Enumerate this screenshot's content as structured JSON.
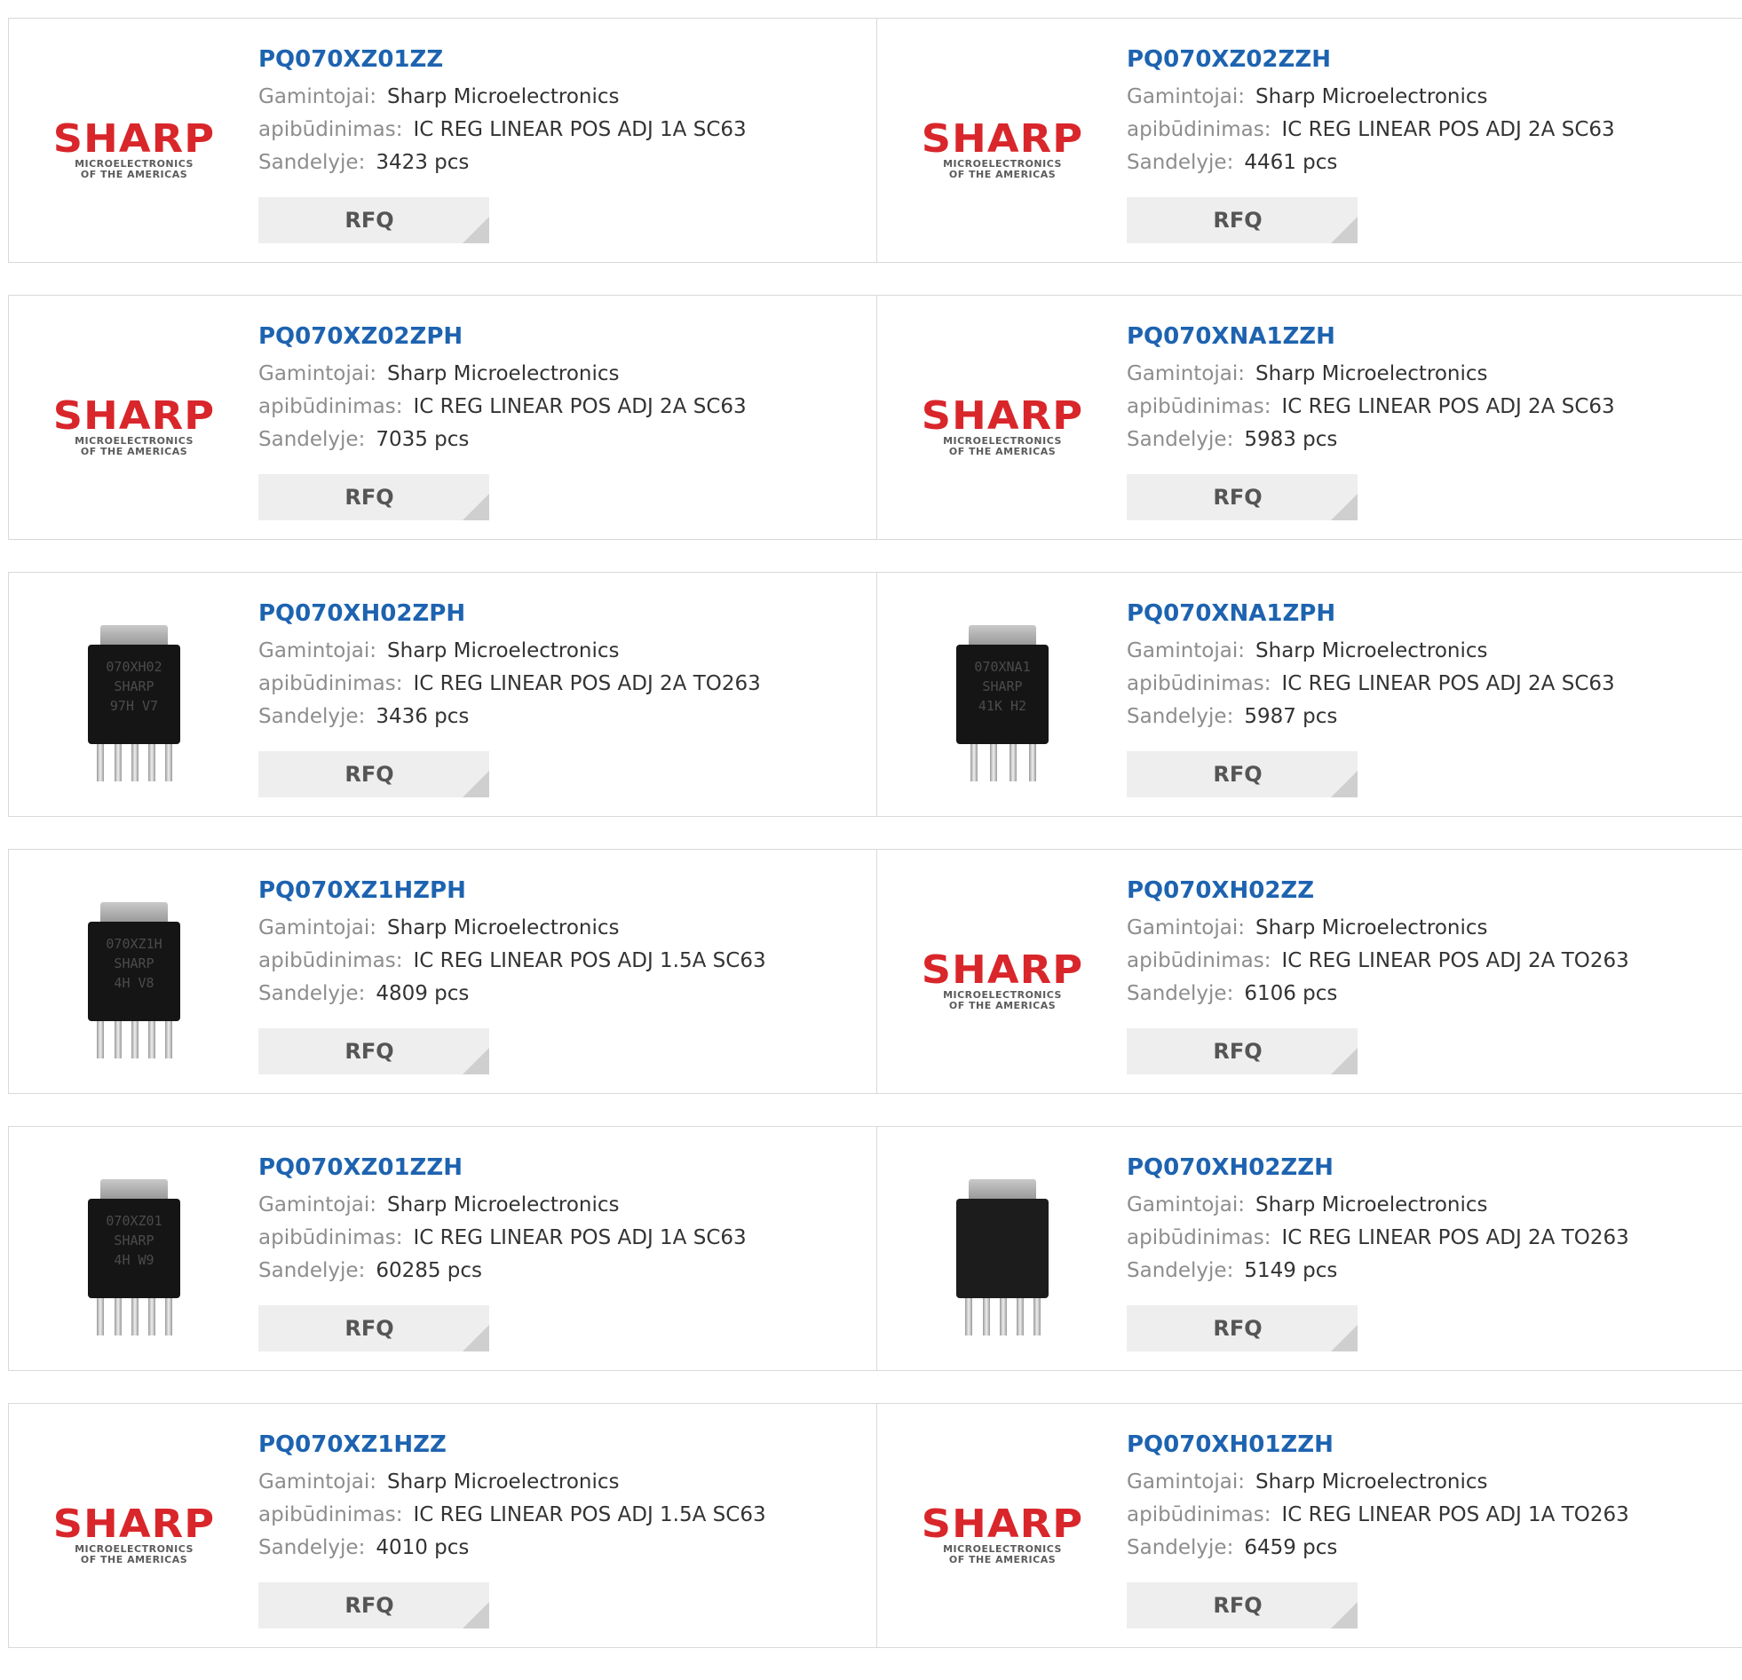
{
  "labels": {
    "manufacturer": "Gamintojai:",
    "description": "apibūdinimas:",
    "stock": "Sandelyje:",
    "rfq": "RFQ"
  },
  "logo": {
    "word": "SHARP",
    "line1": "MICROELECTRONICS",
    "line2": "OF THE AMERICAS",
    "color": "#d8262b"
  },
  "colors": {
    "part_link": "#1d63b0",
    "label": "#8d8d8d",
    "value": "#333333",
    "button_bg": "#eeeeee"
  },
  "products": [
    {
      "part": "PQ070XZ01ZZ",
      "manufacturer": "Sharp Microelectronics",
      "description": "IC REG LINEAR POS ADJ 1A SC63",
      "stock": "3423 pcs",
      "image": "sharp-logo"
    },
    {
      "part": "PQ070XZ02ZZH",
      "manufacturer": "Sharp Microelectronics",
      "description": "IC REG LINEAR POS ADJ 2A SC63",
      "stock": "4461 pcs",
      "image": "sharp-logo"
    },
    {
      "part": "PQ070XZ02ZPH",
      "manufacturer": "Sharp Microelectronics",
      "description": "IC REG LINEAR POS ADJ 2A SC63",
      "stock": "7035 pcs",
      "image": "sharp-logo"
    },
    {
      "part": "PQ070XNA1ZZH",
      "manufacturer": "Sharp Microelectronics",
      "description": "IC REG LINEAR POS ADJ 2A SC63",
      "stock": "5983 pcs",
      "image": "sharp-logo"
    },
    {
      "part": "PQ070XH02ZPH",
      "manufacturer": "Sharp Microelectronics",
      "description": "IC REG LINEAR POS ADJ 2A TO263",
      "stock": "3436 pcs",
      "image": "chip-photo",
      "marking": [
        "070XH02",
        "SHARP",
        "97H V7"
      ]
    },
    {
      "part": "PQ070XNA1ZPH",
      "manufacturer": "Sharp Microelectronics",
      "description": "IC REG LINEAR POS ADJ 2A SC63",
      "stock": "5987 pcs",
      "image": "chip-photo",
      "marking": [
        "070XNA1",
        "SHARP",
        "41K H2"
      ]
    },
    {
      "part": "PQ070XZ1HZPH",
      "manufacturer": "Sharp Microelectronics",
      "description": "IC REG LINEAR POS ADJ 1.5A SC63",
      "stock": "4809 pcs",
      "image": "chip-photo",
      "marking": [
        "070XZ1H",
        "SHARP",
        "4H V8"
      ]
    },
    {
      "part": "PQ070XH02ZZ",
      "manufacturer": "Sharp Microelectronics",
      "description": "IC REG LINEAR POS ADJ 2A TO263",
      "stock": "6106 pcs",
      "image": "sharp-logo"
    },
    {
      "part": "PQ070XZ01ZZH",
      "manufacturer": "Sharp Microelectronics",
      "description": "IC REG LINEAR POS ADJ 1A SC63",
      "stock": "60285 pcs",
      "image": "chip-photo",
      "marking": [
        "070XZ01",
        "SHARP",
        "4H W9"
      ]
    },
    {
      "part": "PQ070XH02ZZH",
      "manufacturer": "Sharp Microelectronics",
      "description": "IC REG LINEAR POS ADJ 2A TO263",
      "stock": "5149 pcs",
      "image": "chip-photo",
      "marking": [
        "",
        "",
        ""
      ]
    },
    {
      "part": "PQ070XZ1HZZ",
      "manufacturer": "Sharp Microelectronics",
      "description": "IC REG LINEAR POS ADJ 1.5A SC63",
      "stock": "4010 pcs",
      "image": "sharp-logo"
    },
    {
      "part": "PQ070XH01ZZH",
      "manufacturer": "Sharp Microelectronics",
      "description": "IC REG LINEAR POS ADJ 1A TO263",
      "stock": "6459 pcs",
      "image": "sharp-logo"
    }
  ]
}
